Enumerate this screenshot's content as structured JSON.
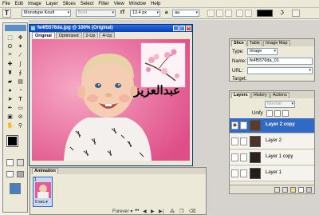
{
  "menu": [
    "File",
    "Edit",
    "Image",
    "Layer",
    "Slices",
    "Select",
    "Filter",
    "View",
    "Window",
    "Help"
  ],
  "options": {
    "font_family": "Monotype Koufi",
    "font_style": "Bold",
    "font_size": "13.4 px",
    "antialias": "aa",
    "color_swatch": "#000000"
  },
  "image_window": {
    "title": "fe4f5576da.jpg @ 100% (Original)",
    "tabs": [
      "Original",
      "Optimized",
      "2-Up",
      "4-Up"
    ],
    "active_tab": "Original",
    "canvas_bg": "#e45b93"
  },
  "watermark": {
    "text": "عبدالعزيز"
  },
  "slice_panel": {
    "tabs": [
      "Slice",
      "Table",
      "Image Map"
    ],
    "type_label": "Type:",
    "type_value": "Image",
    "name_label": "Name:",
    "name_value": "fe4f5576da_01",
    "url_label": "URL:",
    "url_value": "",
    "target_label": "Target:"
  },
  "layers_panel": {
    "tabs": [
      "Layers",
      "History",
      "Actions"
    ],
    "blend_mode": "Normal",
    "unify_label": "Unify",
    "layers": [
      {
        "name": "Layer 2 copy",
        "selected": true
      },
      {
        "name": "Layer 2",
        "selected": false
      },
      {
        "name": "Layer 1 copy",
        "selected": false
      },
      {
        "name": "Layer 1",
        "selected": false
      }
    ]
  },
  "animation": {
    "title": "Animation",
    "frame_number": "1",
    "frame_delay": "0 sec.",
    "loop_option": "Forever"
  }
}
